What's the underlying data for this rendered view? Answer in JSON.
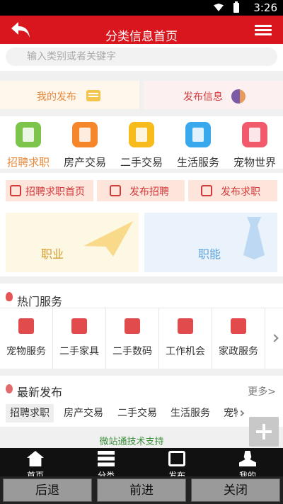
{
  "status": {
    "time": "3:26"
  },
  "header": {
    "title": "分类信息首页"
  },
  "search": {
    "placeholder": "输入类别或者关键字"
  },
  "quick": {
    "my_posts": "我的发布",
    "publish_info": "发布信息"
  },
  "categories": [
    {
      "label": "招聘求职",
      "color": "#7cc44a"
    },
    {
      "label": "房产交易",
      "color": "#f5862a"
    },
    {
      "label": "二手交易",
      "color": "#f7bb1c"
    },
    {
      "label": "生活服务",
      "color": "#3aa8ec"
    },
    {
      "label": "宠物世界",
      "color": "#f05a6a"
    }
  ],
  "job_tabs": {
    "home": "招聘求职首页",
    "post_job": "发布招聘",
    "post_resume": "发布求职"
  },
  "cards": {
    "career": "职业",
    "skill": "职能"
  },
  "hot": {
    "title": "热门服务",
    "items": [
      "宠物服务",
      "二手家具",
      "二手数码",
      "工作机会",
      "家政服务"
    ]
  },
  "latest": {
    "title": "最新发布",
    "more": "更多>",
    "tabs": [
      "招聘求职",
      "房产交易",
      "二手交易",
      "生活服务",
      "宠物世界"
    ]
  },
  "footer_note": "微站通技术支持",
  "nav": {
    "home": "首页",
    "category": "分类",
    "publish": "发布",
    "mine": "我的"
  },
  "browser": {
    "back": "后退",
    "forward": "前进",
    "close": "关闭"
  },
  "colors": {
    "brand": "#d9161e",
    "accent": "#e6893a"
  }
}
